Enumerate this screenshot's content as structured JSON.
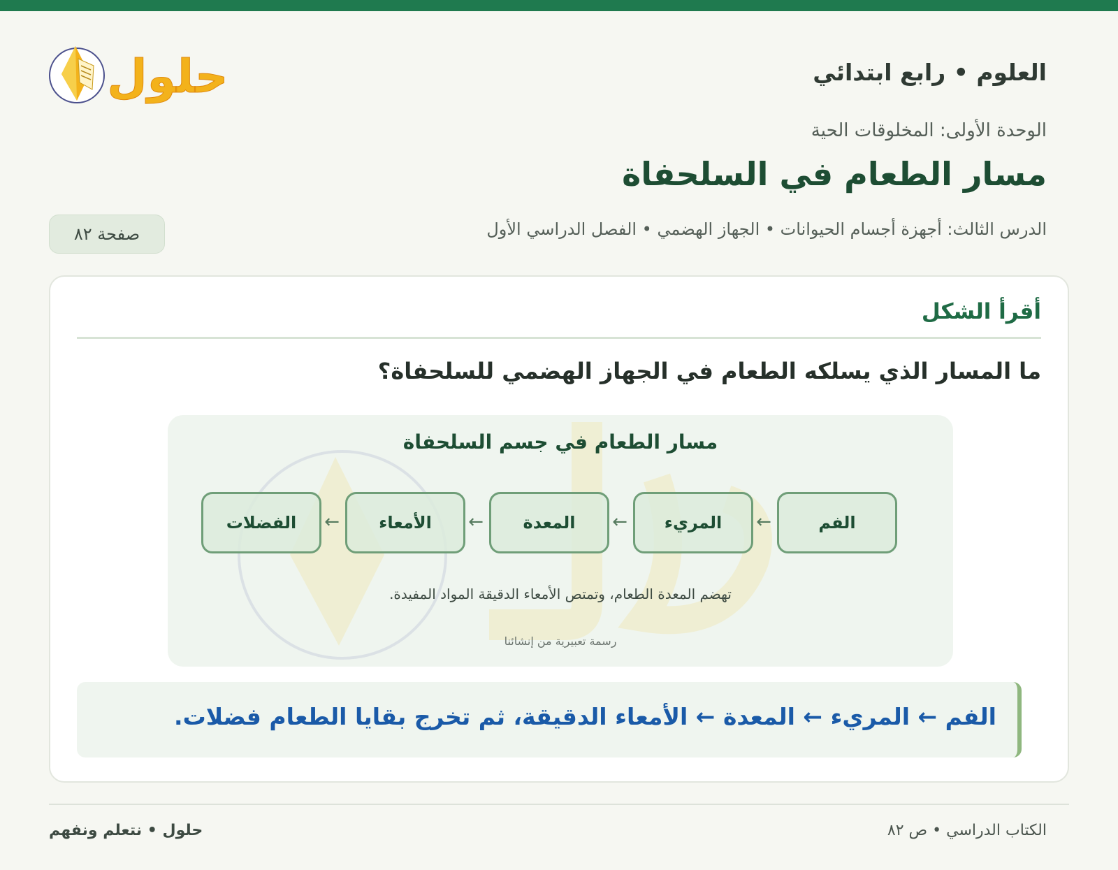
{
  "colors": {
    "accent": "#1f7a4f",
    "title": "#1d4d33",
    "answer": "#1a5aa8",
    "logo_gold": "#f3b21b"
  },
  "header": {
    "subject": "العلوم • رابع ابتدائي",
    "logo_text": "حلول",
    "logo_icon": "book-icon"
  },
  "unit": "الوحدة الأولى: المخلوقات الحية",
  "title": "مسار الطعام في السلحفاة",
  "lesson": "الدرس الثالث: أجهزة أجسام الحيوانات • الجهاز الهضمي • الفصل الدراسي الأول",
  "page_label": "صفحة ٨٢",
  "card": {
    "heading": "أقرأ الشكل",
    "question": "ما المسار الذي يسلكه الطعام في الجهاز الهضمي للسلحفاة؟",
    "figure": {
      "title": "مسار الطعام في جسم السلحفاة",
      "stages": [
        "الفم",
        "المريء",
        "المعدة",
        "الأمعاء",
        "الفضلات"
      ],
      "arrow": "←",
      "caption": "تهضم المعدة الطعام، وتمتص الأمعاء الدقيقة المواد المفيدة.",
      "credit": "رسمة تعبيرية من إنشائنا"
    },
    "answer": "الفم ← المريء ← المعدة ← الأمعاء الدقيقة، ثم تخرج بقايا الطعام فضلات."
  },
  "footer": {
    "right": "الكتاب الدراسي • ص ٨٢",
    "left": "حلول • نتعلم ونفهم"
  }
}
